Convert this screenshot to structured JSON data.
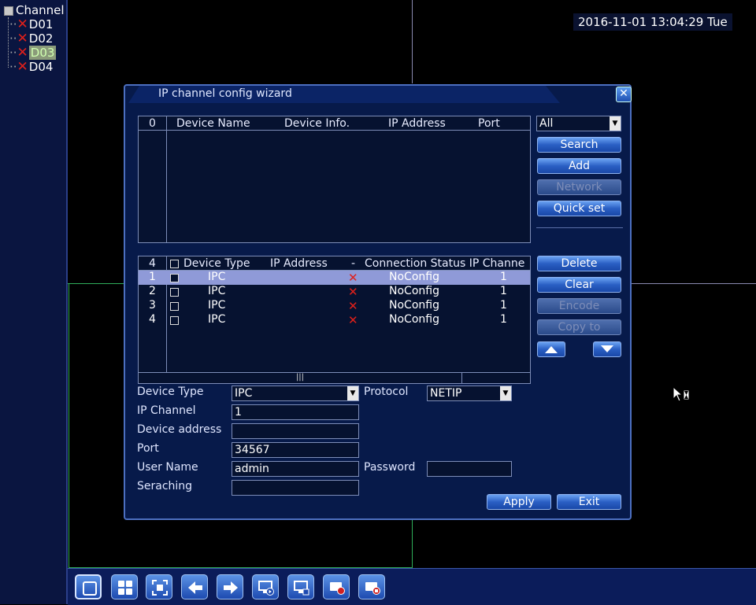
{
  "sidebar": {
    "root_label": "Channel",
    "items": [
      {
        "label": "D01",
        "selected": false
      },
      {
        "label": "D02",
        "selected": false
      },
      {
        "label": "D03",
        "selected": true
      },
      {
        "label": "D04",
        "selected": false
      }
    ]
  },
  "datetime": "2016-11-01 13:04:29 Tue",
  "dialog": {
    "title": "IP channel config wizard",
    "close_icon": "close-icon",
    "search_table": {
      "count": "0",
      "headers": [
        "Device Name",
        "Device Info.",
        "IP Address",
        "Port"
      ],
      "rows": []
    },
    "filter_select": "All",
    "buttons_top": {
      "search": "Search",
      "add": "Add",
      "network": "Network",
      "quick_set": "Quick set"
    },
    "device_table": {
      "count": "4",
      "headers": [
        "Device Type",
        "IP Address",
        "-",
        "Connection Status",
        "IP Channe"
      ],
      "rows": [
        {
          "index": "1",
          "type": "IPC",
          "status": "NoConfig",
          "channel": "1"
        },
        {
          "index": "2",
          "type": "IPC",
          "status": "NoConfig",
          "channel": "1"
        },
        {
          "index": "3",
          "type": "IPC",
          "status": "NoConfig",
          "channel": "1"
        },
        {
          "index": "4",
          "type": "IPC",
          "status": "NoConfig",
          "channel": "1"
        }
      ],
      "scroll_grip": "|||"
    },
    "buttons_mid": {
      "delete": "Delete",
      "clear": "Clear",
      "encode": "Encode",
      "copy_to": "Copy to"
    },
    "form": {
      "device_type_label": "Device Type",
      "device_type_value": "IPC",
      "protocol_label": "Protocol",
      "protocol_value": "NETIP",
      "ip_channel_label": "IP Channel",
      "ip_channel_value": "1",
      "device_address_label": "Device address",
      "device_address_value": "",
      "port_label": "Port",
      "port_value": "34567",
      "user_name_label": "User Name",
      "user_name_value": "admin",
      "password_label": "Password",
      "password_value": "",
      "searching_label": "Seraching",
      "searching_value": ""
    },
    "apply_label": "Apply",
    "exit_label": "Exit"
  },
  "taskbar": {
    "icons": [
      "single-view-icon",
      "quad-view-icon",
      "fullscreen-icon",
      "prev-icon",
      "next-icon",
      "playback-icon",
      "monitor-icon",
      "record-icon",
      "stop-record-icon"
    ]
  },
  "colors": {
    "dialog_bg": "#071a4a",
    "accent_blue": "#2a5fc4",
    "error_red": "#e0201a",
    "selected_row": "#8f9ad8"
  }
}
